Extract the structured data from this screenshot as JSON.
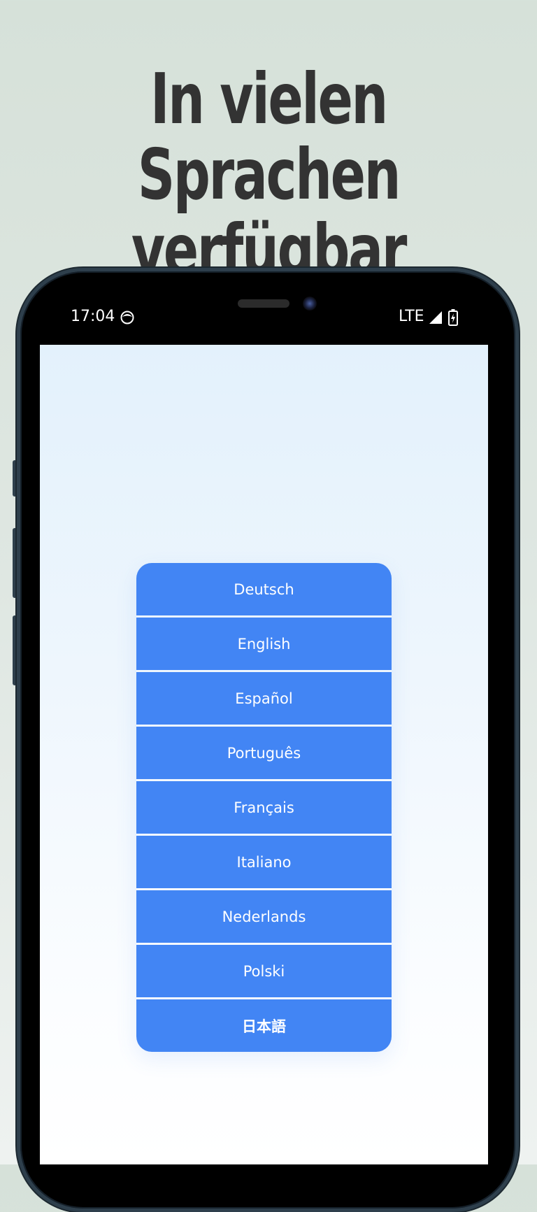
{
  "headline": {
    "line1": "In vielen Sprachen",
    "line2": "verfügbar"
  },
  "status_bar": {
    "time": "17:04",
    "network": "LTE",
    "icons": [
      "face-icon",
      "signal-icon",
      "battery-charging-icon"
    ]
  },
  "languages": [
    {
      "label": "Deutsch"
    },
    {
      "label": "English"
    },
    {
      "label": "Español"
    },
    {
      "label": "Português"
    },
    {
      "label": "Français"
    },
    {
      "label": "Italiano"
    },
    {
      "label": "Nederlands"
    },
    {
      "label": "Polski"
    },
    {
      "label": "日本語"
    }
  ],
  "colors": {
    "button": "#4285f4",
    "headline": "#333333",
    "background": "#d6e1d9"
  }
}
